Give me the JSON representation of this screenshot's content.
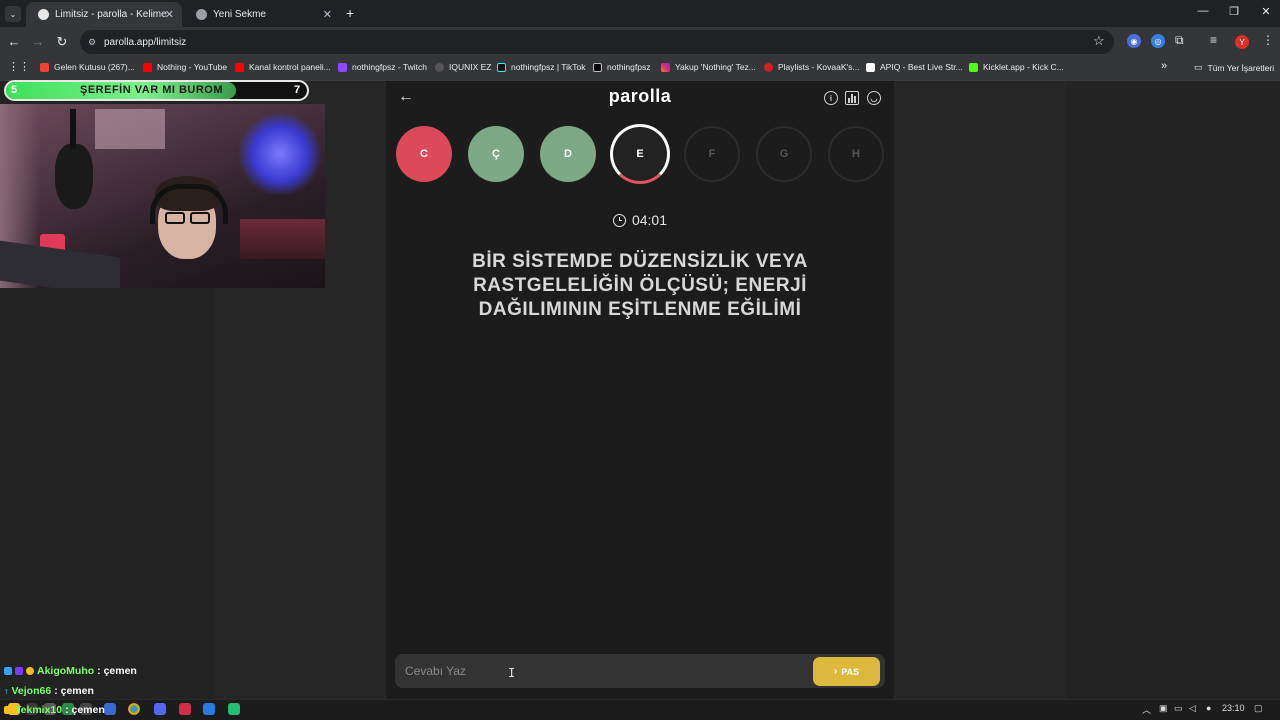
{
  "browser": {
    "tabs": [
      {
        "title": "Limitsiz - parolla - Kelime oyunu",
        "active": true
      },
      {
        "title": "Yeni Sekme",
        "active": false
      }
    ],
    "new_tab_symbol": "+",
    "url": "parolla.app/limitsiz",
    "bookmarks": [
      {
        "label": "Gelen Kutusu (267)...",
        "color": "#ea4335"
      },
      {
        "label": "Nothing - YouTube",
        "color": "#ff0000"
      },
      {
        "label": "Kanal kontrol paneli...",
        "color": "#ff0000"
      },
      {
        "label": "nothingfpsz - Twitch",
        "color": "#9146ff"
      },
      {
        "label": "IQUNIX EZ",
        "color": "#444444"
      },
      {
        "label": "nothingfpsz | TikTok",
        "color": "#111111"
      },
      {
        "label": "nothingfpsz",
        "color": "#000000"
      },
      {
        "label": "Yakup 'Nothing' Tez...",
        "color": "#e1306c"
      },
      {
        "label": "Playlists - KovaaK's...",
        "color": "#cc2222"
      },
      {
        "label": "APIQ - Best Live Str...",
        "color": "#ffffff"
      },
      {
        "label": "Kicklet.app - Kick C...",
        "color": "#53fc18"
      }
    ],
    "all_bookmarks_label": "Tüm Yer İşaretleri",
    "profile_initial": "Y"
  },
  "app": {
    "brand": "parolla",
    "letters": [
      {
        "char": "C",
        "state": "wrong"
      },
      {
        "char": "Ç",
        "state": "right"
      },
      {
        "char": "D",
        "state": "right"
      },
      {
        "char": "E",
        "state": "current"
      },
      {
        "char": "F",
        "state": "pending"
      },
      {
        "char": "G",
        "state": "pending"
      },
      {
        "char": "H",
        "state": "pending"
      }
    ],
    "timer": "04:01",
    "question": "BİR SİSTEMDE DÜZENSİZLİK VEYA RASTGELELİĞİN ÖLÇÜSÜ; ENERJİ DAĞILIMININ EŞİTLENME EĞİLİMİ",
    "answer_placeholder": "Cevabı Yaz",
    "pass_label": "PAS",
    "colors": {
      "wrong": "#dc4a5a",
      "right": "#7ea986",
      "pass": "#dcb93c"
    }
  },
  "overlay": {
    "banner_left": "5",
    "banner_text": "ŞEREFİN VAR MI BUROM",
    "banner_right": "7",
    "chat": [
      {
        "user": "AkigoMuho",
        "message": ": çemen",
        "color": "#7cff6b"
      },
      {
        "user": "Vejon66",
        "message": ": çemen",
        "color": "#7cff6b"
      },
      {
        "user": "Tekmix10",
        "message": ": çemen",
        "color": "#7cff6b"
      }
    ]
  },
  "taskbar": {
    "time": "23:10"
  }
}
